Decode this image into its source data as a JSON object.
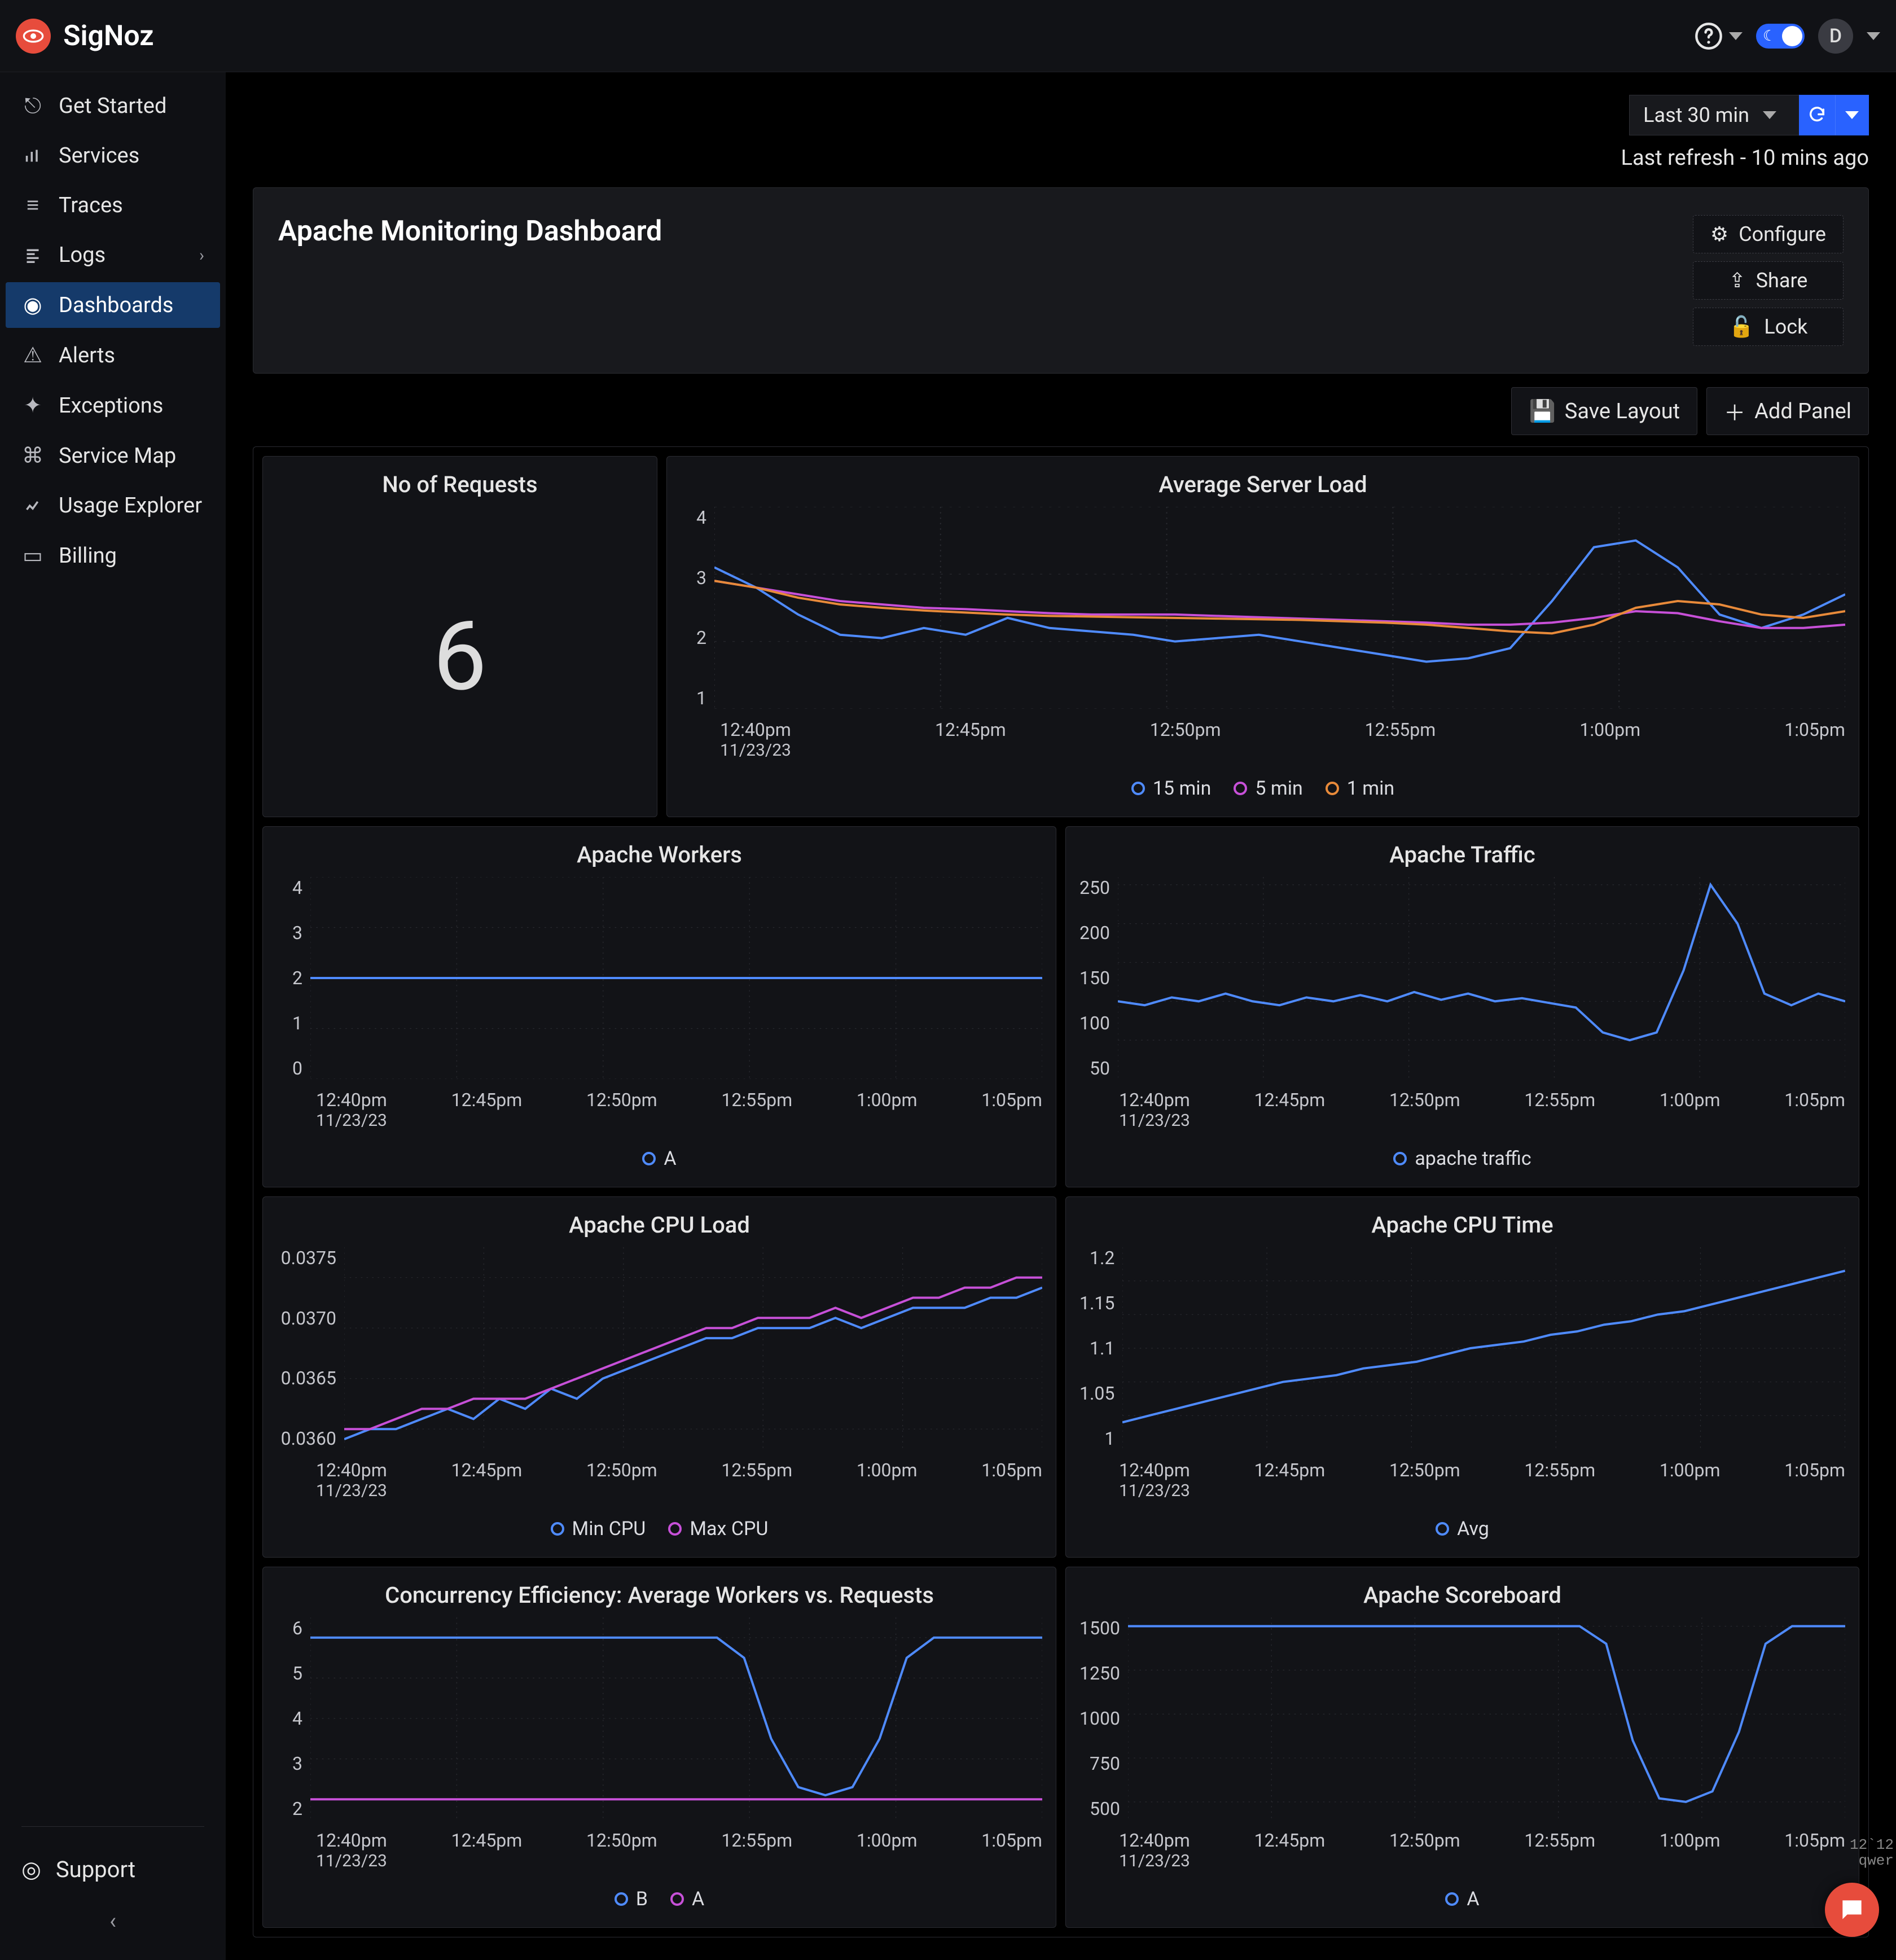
{
  "brand": {
    "name": "SigNoz"
  },
  "header": {
    "avatar_initial": "D",
    "time_range_label": "Last 30 min",
    "last_refresh": "Last refresh - 10 mins ago"
  },
  "sidebar": {
    "items": [
      {
        "label": "Get Started"
      },
      {
        "label": "Services"
      },
      {
        "label": "Traces"
      },
      {
        "label": "Logs",
        "expandable": true
      },
      {
        "label": "Dashboards",
        "active": true
      },
      {
        "label": "Alerts"
      },
      {
        "label": "Exceptions"
      },
      {
        "label": "Service Map"
      },
      {
        "label": "Usage Explorer"
      },
      {
        "label": "Billing"
      }
    ],
    "support_label": "Support"
  },
  "dashboard": {
    "title": "Apache Monitoring Dashboard",
    "actions": {
      "configure": "Configure",
      "share": "Share",
      "lock": "Lock"
    },
    "layout_actions": {
      "save": "Save Layout",
      "add": "Add Panel"
    }
  },
  "chart_data": [
    {
      "id": "no_of_requests",
      "type": "stat",
      "title": "No of Requests",
      "value": 6
    },
    {
      "id": "avg_server_load",
      "type": "line",
      "title": "Average Server Load",
      "xlabel": "",
      "ylabel": "",
      "ylim": [
        1,
        4
      ],
      "yticks": [
        1,
        2,
        3,
        4
      ],
      "xticks": [
        "12:40pm",
        "12:45pm",
        "12:50pm",
        "12:55pm",
        "1:00pm",
        "1:05pm"
      ],
      "xtick_sub": "11/23/23",
      "series": [
        {
          "name": "15 min",
          "color": "#4f8bff",
          "values": [
            3.1,
            2.8,
            2.4,
            2.1,
            2.05,
            2.2,
            2.1,
            2.35,
            2.2,
            2.15,
            2.1,
            2.0,
            2.05,
            2.1,
            2.0,
            1.9,
            1.8,
            1.7,
            1.75,
            1.9,
            2.6,
            3.4,
            3.5,
            3.1,
            2.4,
            2.2,
            2.4,
            2.7
          ]
        },
        {
          "name": "5 min",
          "color": "#c750d8",
          "values": [
            2.9,
            2.8,
            2.7,
            2.6,
            2.55,
            2.5,
            2.48,
            2.45,
            2.42,
            2.4,
            2.4,
            2.4,
            2.38,
            2.36,
            2.34,
            2.32,
            2.3,
            2.28,
            2.25,
            2.25,
            2.28,
            2.35,
            2.45,
            2.42,
            2.3,
            2.2,
            2.2,
            2.25
          ]
        },
        {
          "name": "1 min",
          "color": "#e88a3a",
          "values": [
            2.9,
            2.8,
            2.65,
            2.55,
            2.5,
            2.46,
            2.43,
            2.4,
            2.38,
            2.37,
            2.36,
            2.35,
            2.34,
            2.33,
            2.32,
            2.3,
            2.28,
            2.25,
            2.2,
            2.15,
            2.12,
            2.25,
            2.5,
            2.6,
            2.55,
            2.4,
            2.35,
            2.45
          ]
        }
      ]
    },
    {
      "id": "apache_workers",
      "type": "line",
      "title": "Apache Workers",
      "ylim": [
        0,
        4
      ],
      "yticks": [
        0,
        1,
        2,
        3,
        4
      ],
      "xticks": [
        "12:40pm",
        "12:45pm",
        "12:50pm",
        "12:55pm",
        "1:00pm",
        "1:05pm"
      ],
      "xtick_sub": "11/23/23",
      "series": [
        {
          "name": "A",
          "color": "#4f8bff",
          "values": [
            2,
            2,
            2,
            2,
            2,
            2,
            2,
            2,
            2,
            2,
            2,
            2,
            2,
            2,
            2,
            2,
            2,
            2,
            2,
            2,
            2,
            2,
            2,
            2,
            2,
            2,
            2,
            2
          ]
        }
      ]
    },
    {
      "id": "apache_traffic",
      "type": "line",
      "title": "Apache Traffic",
      "ylim": [
        0,
        260
      ],
      "yticks": [
        50,
        100,
        150,
        200,
        250
      ],
      "xticks": [
        "12:40pm",
        "12:45pm",
        "12:50pm",
        "12:55pm",
        "1:00pm",
        "1:05pm"
      ],
      "xtick_sub": "11/23/23",
      "series": [
        {
          "name": "apache traffic",
          "color": "#4f8bff",
          "values": [
            100,
            95,
            105,
            100,
            110,
            100,
            95,
            105,
            100,
            108,
            100,
            112,
            102,
            110,
            100,
            104,
            98,
            92,
            60,
            50,
            60,
            140,
            250,
            200,
            110,
            95,
            110,
            100
          ]
        }
      ]
    },
    {
      "id": "apache_cpu_load",
      "type": "line",
      "title": "Apache CPU Load",
      "ylim": [
        0.0358,
        0.0378
      ],
      "yticks": [
        0.036,
        0.0365,
        0.037,
        0.0375
      ],
      "xticks": [
        "12:40pm",
        "12:45pm",
        "12:50pm",
        "12:55pm",
        "1:00pm",
        "1:05pm"
      ],
      "xtick_sub": "11/23/23",
      "series": [
        {
          "name": "Min CPU",
          "color": "#4f8bff",
          "values": [
            0.0359,
            0.036,
            0.036,
            0.0361,
            0.0362,
            0.0361,
            0.0363,
            0.0362,
            0.0364,
            0.0363,
            0.0365,
            0.0366,
            0.0367,
            0.0368,
            0.0369,
            0.0369,
            0.037,
            0.037,
            0.037,
            0.0371,
            0.037,
            0.0371,
            0.0372,
            0.0372,
            0.0372,
            0.0373,
            0.0373,
            0.0374
          ]
        },
        {
          "name": "Max CPU",
          "color": "#c750d8",
          "values": [
            0.036,
            0.036,
            0.0361,
            0.0362,
            0.0362,
            0.0363,
            0.0363,
            0.0363,
            0.0364,
            0.0365,
            0.0366,
            0.0367,
            0.0368,
            0.0369,
            0.037,
            0.037,
            0.0371,
            0.0371,
            0.0371,
            0.0372,
            0.0371,
            0.0372,
            0.0373,
            0.0373,
            0.0374,
            0.0374,
            0.0375,
            0.0375
          ]
        }
      ]
    },
    {
      "id": "apache_cpu_time",
      "type": "line",
      "title": "Apache CPU Time",
      "ylim": [
        0.95,
        1.25
      ],
      "yticks": [
        1,
        1.05,
        1.1,
        1.15,
        1.2
      ],
      "xticks": [
        "12:40pm",
        "12:45pm",
        "12:50pm",
        "12:55pm",
        "1:00pm",
        "1:05pm"
      ],
      "xtick_sub": "11/23/23",
      "series": [
        {
          "name": "Avg",
          "color": "#4f8bff",
          "values": [
            0.99,
            1.0,
            1.01,
            1.02,
            1.03,
            1.04,
            1.05,
            1.055,
            1.06,
            1.07,
            1.075,
            1.08,
            1.09,
            1.1,
            1.105,
            1.11,
            1.12,
            1.125,
            1.135,
            1.14,
            1.15,
            1.155,
            1.165,
            1.175,
            1.185,
            1.195,
            1.205,
            1.215
          ]
        }
      ]
    },
    {
      "id": "concurrency_efficiency",
      "type": "line",
      "title": "Concurrency Efficiency: Average Workers vs. Requests",
      "ylim": [
        1.5,
        6.5
      ],
      "yticks": [
        2,
        3,
        4,
        5,
        6
      ],
      "xticks": [
        "12:40pm",
        "12:45pm",
        "12:50pm",
        "12:55pm",
        "1:00pm",
        "1:05pm"
      ],
      "xtick_sub": "11/23/23",
      "series": [
        {
          "name": "B",
          "color": "#4f8bff",
          "values": [
            6,
            6,
            6,
            6,
            6,
            6,
            6,
            6,
            6,
            6,
            6,
            6,
            6,
            6,
            6,
            6,
            5.5,
            3.5,
            2.3,
            2.1,
            2.3,
            3.5,
            5.5,
            6,
            6,
            6,
            6,
            6
          ]
        },
        {
          "name": "A",
          "color": "#c750d8",
          "values": [
            2,
            2,
            2,
            2,
            2,
            2,
            2,
            2,
            2,
            2,
            2,
            2,
            2,
            2,
            2,
            2,
            2,
            2,
            2,
            2,
            2,
            2,
            2,
            2,
            2,
            2,
            2,
            2
          ]
        }
      ]
    },
    {
      "id": "apache_scoreboard",
      "type": "line",
      "title": "Apache Scoreboard",
      "ylim": [
        400,
        1550
      ],
      "yticks": [
        500,
        750,
        1000,
        1250,
        1500
      ],
      "xticks": [
        "12:40pm",
        "12:45pm",
        "12:50pm",
        "12:55pm",
        "1:00pm",
        "1:05pm"
      ],
      "xtick_sub": "11/23/23",
      "series": [
        {
          "name": "A",
          "color": "#4f8bff",
          "values": [
            1500,
            1500,
            1500,
            1500,
            1500,
            1500,
            1500,
            1500,
            1500,
            1500,
            1500,
            1500,
            1500,
            1500,
            1500,
            1500,
            1500,
            1500,
            1400,
            850,
            520,
            500,
            560,
            900,
            1400,
            1500,
            1500,
            1500
          ]
        }
      ]
    }
  ],
  "overlay": {
    "line1": "12`12",
    "line2": "qwer"
  }
}
